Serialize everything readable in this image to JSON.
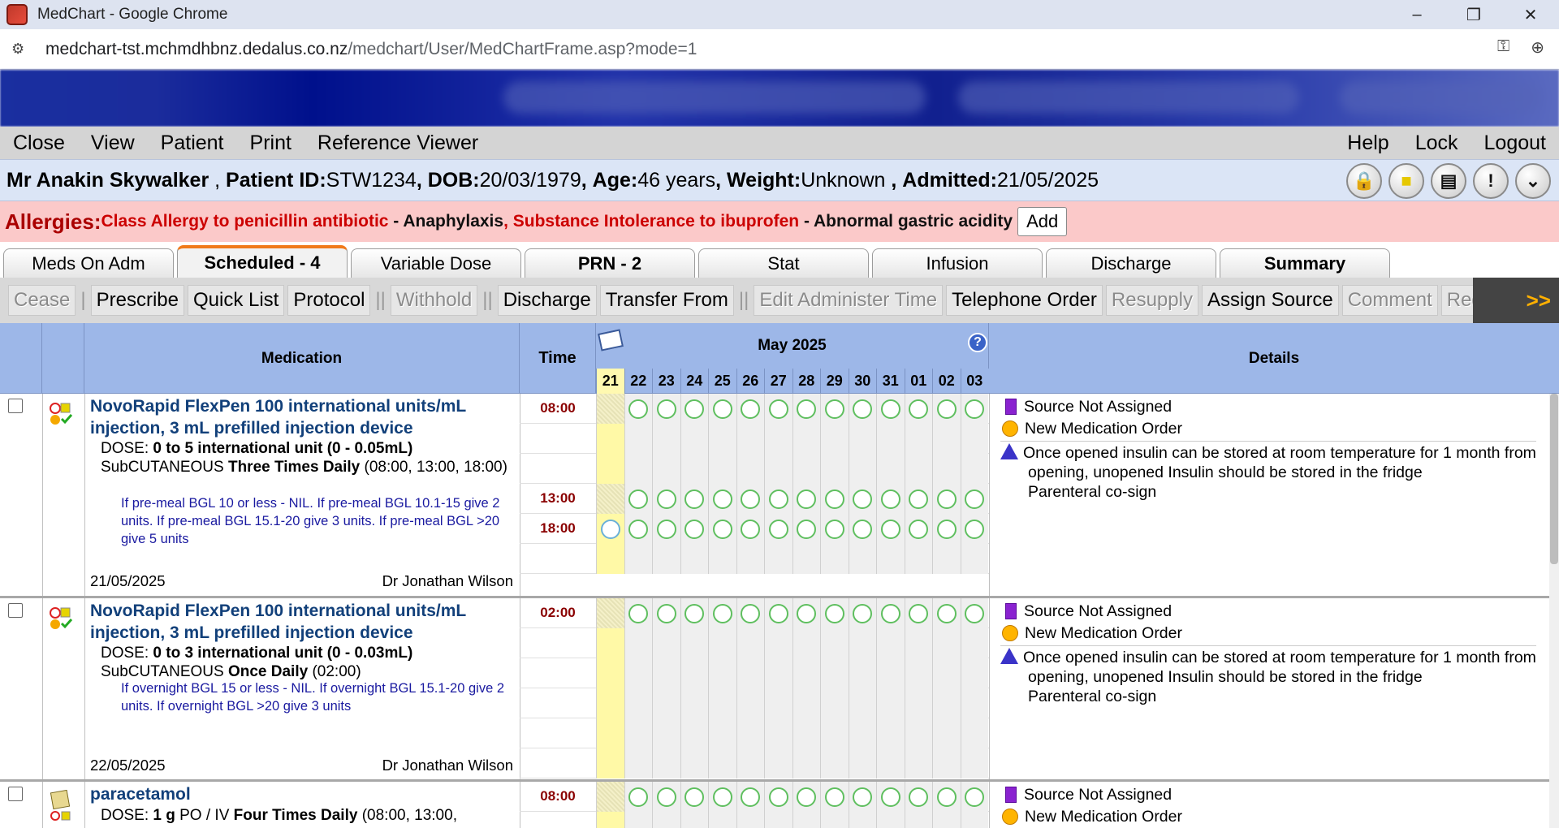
{
  "window": {
    "title": "MedChart - Google Chrome",
    "minimize": "–",
    "restore": "❐",
    "close": "✕"
  },
  "browser": {
    "url_host": "medchart-tst.mchmdhbnz.dedalus.co.nz",
    "url_path": "/medchart/User/MedChartFrame.asp?mode=1"
  },
  "menu": {
    "left": [
      "Close",
      "View",
      "Patient",
      "Print",
      "Reference Viewer"
    ],
    "right": [
      "Help",
      "Lock",
      "Logout"
    ]
  },
  "patient": {
    "name": "Mr Anakin Skywalker",
    "id_label": "Patient ID:",
    "id": "STW1234",
    "dob_label": "DOB:",
    "dob": "20/03/1979",
    "age_label": "Age:",
    "age": "46 years",
    "weight_label": "Weight:",
    "weight": "Unknown",
    "admitted_label": "Admitted:",
    "admitted": "21/05/2025"
  },
  "allergies": {
    "label": "Allergies:",
    "a1": "Class Allergy to penicillin antibiotic",
    "r1": " - Anaphylaxis",
    "a2": ", Substance Intolerance to ibuprofen",
    "r2": " - Abnormal gastric acidity",
    "add": "Add"
  },
  "tabs": [
    "Meds On Adm",
    "Scheduled - 4",
    "Variable Dose",
    "PRN - 2",
    "Stat",
    "Infusion",
    "Discharge",
    "Summary"
  ],
  "toolbar": [
    "Cease",
    "Prescribe",
    "Quick List",
    "Protocol",
    "Withhold",
    "Discharge",
    "Transfer From",
    "Edit Administer Time",
    "Telephone Order",
    "Resupply",
    "Assign Source",
    "Comment",
    "Request Resupply"
  ],
  "toolbar_more": ">>",
  "grid": {
    "col_medication": "Medication",
    "col_time": "Time",
    "col_details": "Details",
    "month": "May 2025",
    "days": [
      "21",
      "22",
      "23",
      "24",
      "25",
      "26",
      "27",
      "28",
      "29",
      "30",
      "31",
      "01",
      "02",
      "03"
    ]
  },
  "meds": [
    {
      "name": "NovoRapid FlexPen 100 international units/mL injection, 3 mL prefilled injection device",
      "dose_label": "DOSE: ",
      "dose": "0 to 5 international unit (0 - 0.05mL)",
      "route": "SubCUTANEOUS ",
      "freq": "Three Times Daily",
      "times_text": " (08:00, 13:00, 18:00)",
      "note": "If pre-meal BGL 10 or less - NIL. If pre-meal BGL 10.1-15 give 2 units. If pre-meal BGL 15.1-20 give 3 units. If pre-meal BGL >20 give 5 units",
      "start": "21/05/2025",
      "doctor": "Dr Jonathan Wilson",
      "slots": [
        "08:00",
        "",
        "",
        "13:00",
        "18:00",
        ""
      ],
      "details": {
        "source": "Source Not Assigned",
        "order": "New Medication Order",
        "comment": "Once opened insulin can be stored at room temperature for 1 month from opening, unopened Insulin should be stored in the fridge",
        "cosign": "Parenteral co-sign"
      }
    },
    {
      "name": "NovoRapid FlexPen 100 international units/mL injection, 3 mL prefilled injection device",
      "dose_label": "DOSE: ",
      "dose": "0 to 3 international unit (0 - 0.03mL)",
      "route": "SubCUTANEOUS ",
      "freq": "Once Daily",
      "times_text": " (02:00)",
      "note": "If overnight BGL 15 or less - NIL. If overnight BGL 15.1-20 give 2 units. If overnight BGL >20 give 3 units",
      "start": "22/05/2025",
      "doctor": "Dr Jonathan Wilson",
      "slots": [
        "02:00",
        "",
        "",
        "",
        "",
        ""
      ],
      "details": {
        "source": "Source Not Assigned",
        "order": "New Medication Order",
        "comment": "Once opened insulin can be stored at room temperature for 1 month from opening, unopened Insulin should be stored in the fridge",
        "cosign": "Parenteral co-sign"
      }
    },
    {
      "name": "paracetamol",
      "dose_label": "DOSE: ",
      "dose": "1 g",
      "route_text": " PO / IV ",
      "freq": "Four Times Daily",
      "times_text": " (08:00, 13:00,",
      "slots": [
        "08:00"
      ],
      "details": {
        "source": "Source Not Assigned",
        "order": "New Medication Order"
      }
    }
  ],
  "colors": {
    "accent_tab": "#f07a1a",
    "header_blue": "#9db7e8",
    "allergy_bg": "#fbc9c9",
    "today": "#fff9a6",
    "given_circle": "#5fbf5f"
  }
}
